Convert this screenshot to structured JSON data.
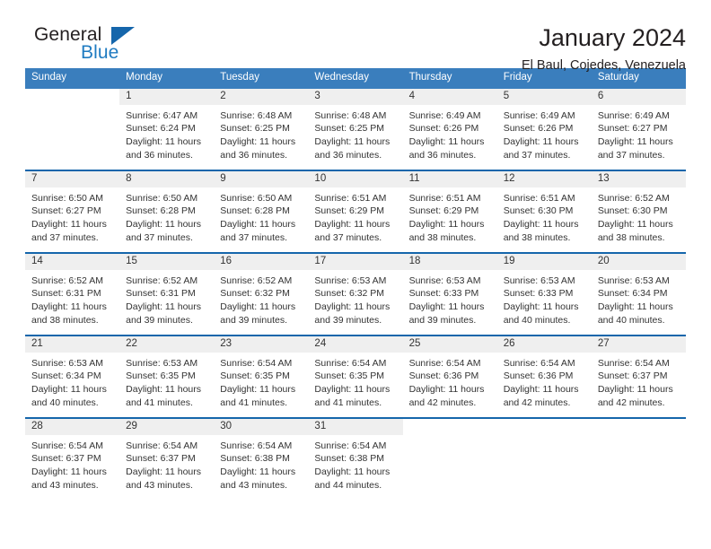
{
  "logo": {
    "word_one": "General",
    "word_two": "Blue",
    "triangle_icon": "triangle-icon",
    "accent_color": "#1566ab",
    "blue_text_color": "#1f7bc1"
  },
  "header": {
    "title": "January 2024",
    "location": "El Baul, Cojedes, Venezuela"
  },
  "calendar": {
    "header_bg": "#3a7ebd",
    "row_border_color": "#1566ab",
    "daynum_bg": "#efefef",
    "weekdays": [
      "Sunday",
      "Monday",
      "Tuesday",
      "Wednesday",
      "Thursday",
      "Friday",
      "Saturday"
    ],
    "weeks": [
      [
        {
          "day": ""
        },
        {
          "day": "1",
          "sunrise": "Sunrise: 6:47 AM",
          "sunset": "Sunset: 6:24 PM",
          "daylight_line1": "Daylight: 11 hours",
          "daylight_line2": "and 36 minutes."
        },
        {
          "day": "2",
          "sunrise": "Sunrise: 6:48 AM",
          "sunset": "Sunset: 6:25 PM",
          "daylight_line1": "Daylight: 11 hours",
          "daylight_line2": "and 36 minutes."
        },
        {
          "day": "3",
          "sunrise": "Sunrise: 6:48 AM",
          "sunset": "Sunset: 6:25 PM",
          "daylight_line1": "Daylight: 11 hours",
          "daylight_line2": "and 36 minutes."
        },
        {
          "day": "4",
          "sunrise": "Sunrise: 6:49 AM",
          "sunset": "Sunset: 6:26 PM",
          "daylight_line1": "Daylight: 11 hours",
          "daylight_line2": "and 36 minutes."
        },
        {
          "day": "5",
          "sunrise": "Sunrise: 6:49 AM",
          "sunset": "Sunset: 6:26 PM",
          "daylight_line1": "Daylight: 11 hours",
          "daylight_line2": "and 37 minutes."
        },
        {
          "day": "6",
          "sunrise": "Sunrise: 6:49 AM",
          "sunset": "Sunset: 6:27 PM",
          "daylight_line1": "Daylight: 11 hours",
          "daylight_line2": "and 37 minutes."
        }
      ],
      [
        {
          "day": "7",
          "sunrise": "Sunrise: 6:50 AM",
          "sunset": "Sunset: 6:27 PM",
          "daylight_line1": "Daylight: 11 hours",
          "daylight_line2": "and 37 minutes."
        },
        {
          "day": "8",
          "sunrise": "Sunrise: 6:50 AM",
          "sunset": "Sunset: 6:28 PM",
          "daylight_line1": "Daylight: 11 hours",
          "daylight_line2": "and 37 minutes."
        },
        {
          "day": "9",
          "sunrise": "Sunrise: 6:50 AM",
          "sunset": "Sunset: 6:28 PM",
          "daylight_line1": "Daylight: 11 hours",
          "daylight_line2": "and 37 minutes."
        },
        {
          "day": "10",
          "sunrise": "Sunrise: 6:51 AM",
          "sunset": "Sunset: 6:29 PM",
          "daylight_line1": "Daylight: 11 hours",
          "daylight_line2": "and 37 minutes."
        },
        {
          "day": "11",
          "sunrise": "Sunrise: 6:51 AM",
          "sunset": "Sunset: 6:29 PM",
          "daylight_line1": "Daylight: 11 hours",
          "daylight_line2": "and 38 minutes."
        },
        {
          "day": "12",
          "sunrise": "Sunrise: 6:51 AM",
          "sunset": "Sunset: 6:30 PM",
          "daylight_line1": "Daylight: 11 hours",
          "daylight_line2": "and 38 minutes."
        },
        {
          "day": "13",
          "sunrise": "Sunrise: 6:52 AM",
          "sunset": "Sunset: 6:30 PM",
          "daylight_line1": "Daylight: 11 hours",
          "daylight_line2": "and 38 minutes."
        }
      ],
      [
        {
          "day": "14",
          "sunrise": "Sunrise: 6:52 AM",
          "sunset": "Sunset: 6:31 PM",
          "daylight_line1": "Daylight: 11 hours",
          "daylight_line2": "and 38 minutes."
        },
        {
          "day": "15",
          "sunrise": "Sunrise: 6:52 AM",
          "sunset": "Sunset: 6:31 PM",
          "daylight_line1": "Daylight: 11 hours",
          "daylight_line2": "and 39 minutes."
        },
        {
          "day": "16",
          "sunrise": "Sunrise: 6:52 AM",
          "sunset": "Sunset: 6:32 PM",
          "daylight_line1": "Daylight: 11 hours",
          "daylight_line2": "and 39 minutes."
        },
        {
          "day": "17",
          "sunrise": "Sunrise: 6:53 AM",
          "sunset": "Sunset: 6:32 PM",
          "daylight_line1": "Daylight: 11 hours",
          "daylight_line2": "and 39 minutes."
        },
        {
          "day": "18",
          "sunrise": "Sunrise: 6:53 AM",
          "sunset": "Sunset: 6:33 PM",
          "daylight_line1": "Daylight: 11 hours",
          "daylight_line2": "and 39 minutes."
        },
        {
          "day": "19",
          "sunrise": "Sunrise: 6:53 AM",
          "sunset": "Sunset: 6:33 PM",
          "daylight_line1": "Daylight: 11 hours",
          "daylight_line2": "and 40 minutes."
        },
        {
          "day": "20",
          "sunrise": "Sunrise: 6:53 AM",
          "sunset": "Sunset: 6:34 PM",
          "daylight_line1": "Daylight: 11 hours",
          "daylight_line2": "and 40 minutes."
        }
      ],
      [
        {
          "day": "21",
          "sunrise": "Sunrise: 6:53 AM",
          "sunset": "Sunset: 6:34 PM",
          "daylight_line1": "Daylight: 11 hours",
          "daylight_line2": "and 40 minutes."
        },
        {
          "day": "22",
          "sunrise": "Sunrise: 6:53 AM",
          "sunset": "Sunset: 6:35 PM",
          "daylight_line1": "Daylight: 11 hours",
          "daylight_line2": "and 41 minutes."
        },
        {
          "day": "23",
          "sunrise": "Sunrise: 6:54 AM",
          "sunset": "Sunset: 6:35 PM",
          "daylight_line1": "Daylight: 11 hours",
          "daylight_line2": "and 41 minutes."
        },
        {
          "day": "24",
          "sunrise": "Sunrise: 6:54 AM",
          "sunset": "Sunset: 6:35 PM",
          "daylight_line1": "Daylight: 11 hours",
          "daylight_line2": "and 41 minutes."
        },
        {
          "day": "25",
          "sunrise": "Sunrise: 6:54 AM",
          "sunset": "Sunset: 6:36 PM",
          "daylight_line1": "Daylight: 11 hours",
          "daylight_line2": "and 42 minutes."
        },
        {
          "day": "26",
          "sunrise": "Sunrise: 6:54 AM",
          "sunset": "Sunset: 6:36 PM",
          "daylight_line1": "Daylight: 11 hours",
          "daylight_line2": "and 42 minutes."
        },
        {
          "day": "27",
          "sunrise": "Sunrise: 6:54 AM",
          "sunset": "Sunset: 6:37 PM",
          "daylight_line1": "Daylight: 11 hours",
          "daylight_line2": "and 42 minutes."
        }
      ],
      [
        {
          "day": "28",
          "sunrise": "Sunrise: 6:54 AM",
          "sunset": "Sunset: 6:37 PM",
          "daylight_line1": "Daylight: 11 hours",
          "daylight_line2": "and 43 minutes."
        },
        {
          "day": "29",
          "sunrise": "Sunrise: 6:54 AM",
          "sunset": "Sunset: 6:37 PM",
          "daylight_line1": "Daylight: 11 hours",
          "daylight_line2": "and 43 minutes."
        },
        {
          "day": "30",
          "sunrise": "Sunrise: 6:54 AM",
          "sunset": "Sunset: 6:38 PM",
          "daylight_line1": "Daylight: 11 hours",
          "daylight_line2": "and 43 minutes."
        },
        {
          "day": "31",
          "sunrise": "Sunrise: 6:54 AM",
          "sunset": "Sunset: 6:38 PM",
          "daylight_line1": "Daylight: 11 hours",
          "daylight_line2": "and 44 minutes."
        },
        {
          "day": ""
        },
        {
          "day": ""
        },
        {
          "day": ""
        }
      ]
    ]
  }
}
